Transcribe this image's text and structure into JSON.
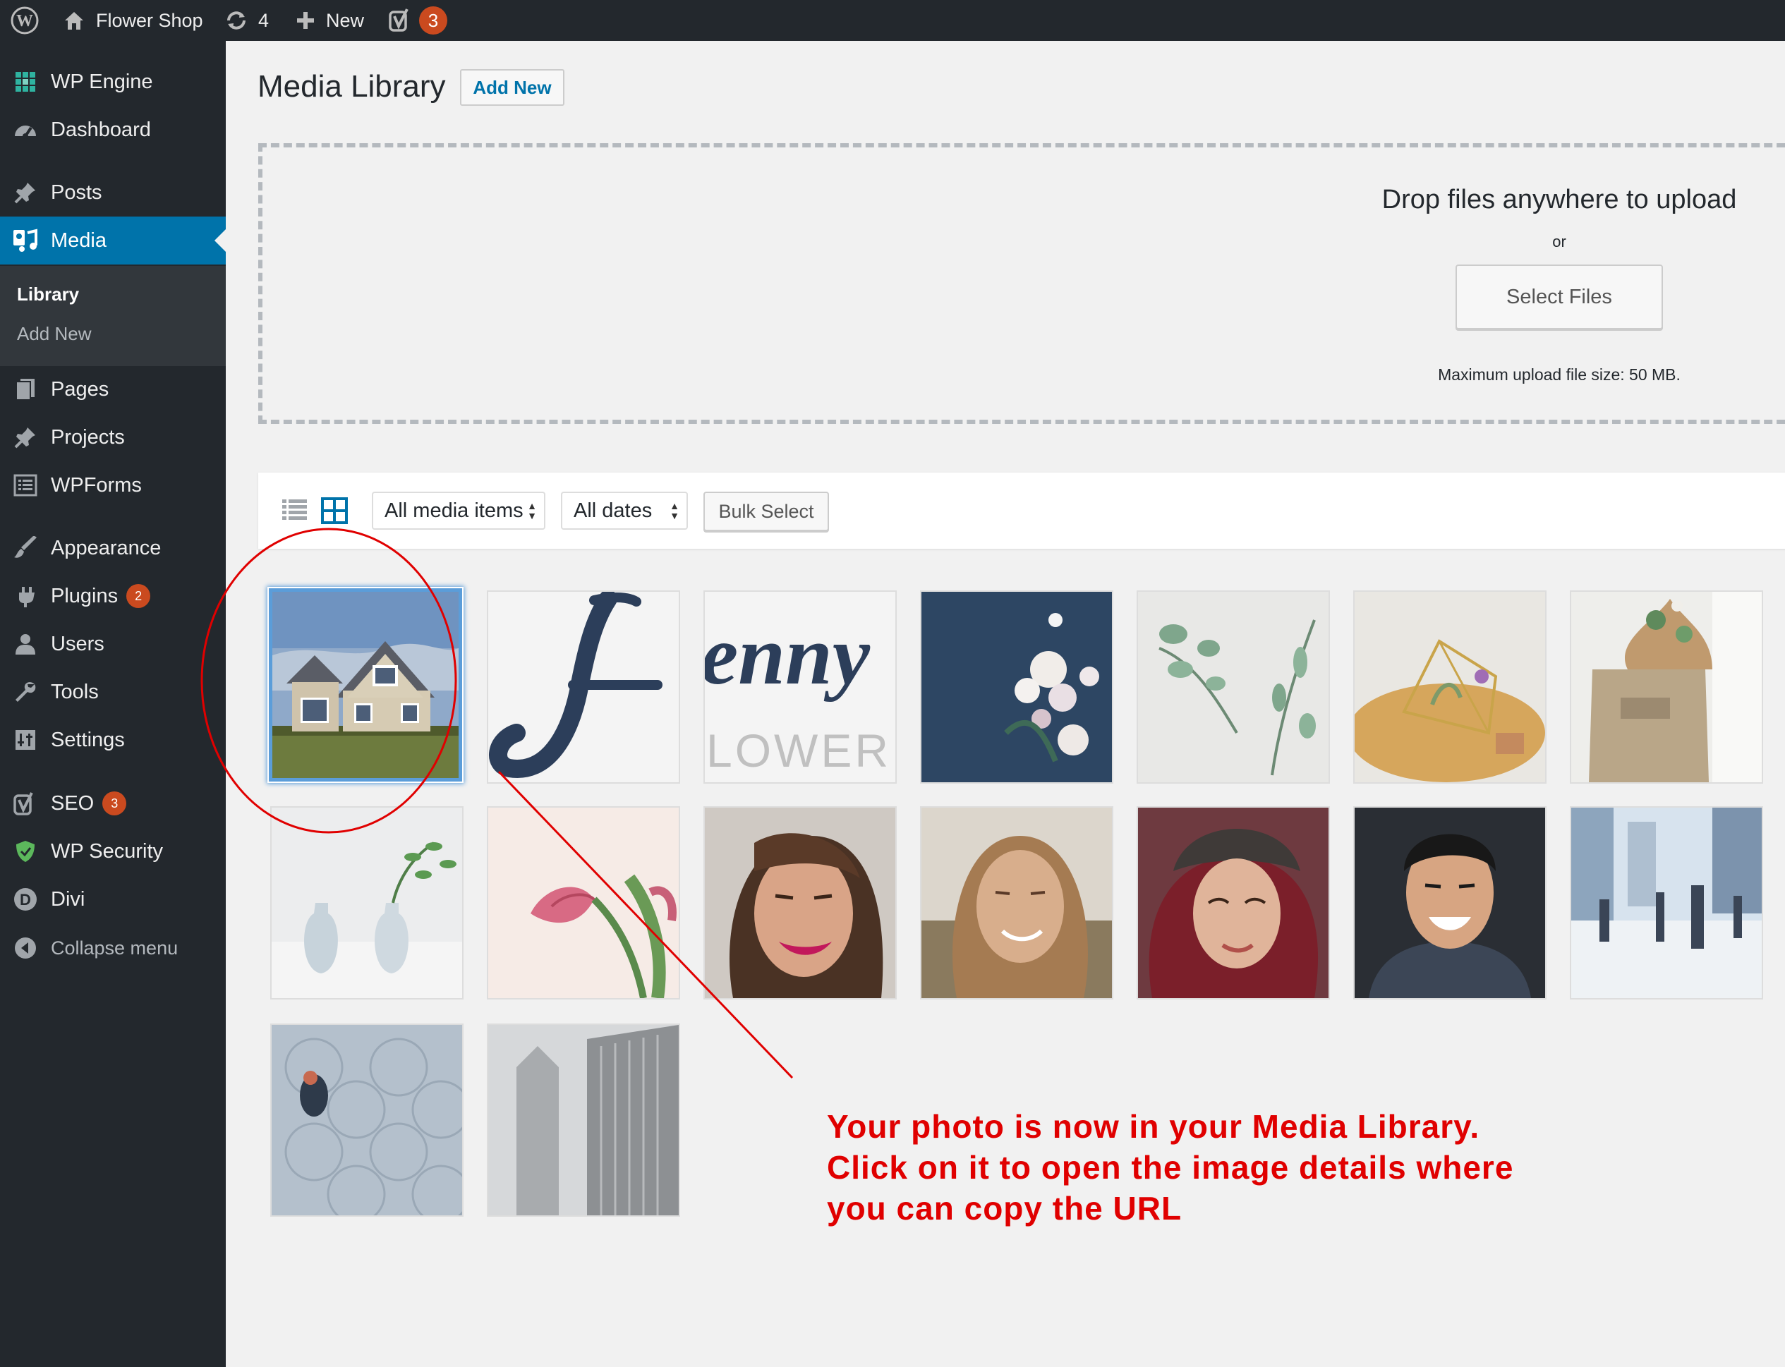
{
  "adminbar": {
    "site_name": "Flower Shop",
    "updates_count": "4",
    "new_label": "New",
    "seo_count": "3"
  },
  "sidebar": {
    "items": [
      {
        "label": "WP Engine",
        "icon": "wp-engine-icon"
      },
      {
        "label": "Dashboard",
        "icon": "dashboard-icon"
      },
      {
        "label": "Posts",
        "icon": "pin-icon"
      },
      {
        "label": "Media",
        "icon": "media-icon"
      },
      {
        "label": "Pages",
        "icon": "pages-icon"
      },
      {
        "label": "Projects",
        "icon": "pin-icon"
      },
      {
        "label": "WPForms",
        "icon": "forms-icon"
      },
      {
        "label": "Appearance",
        "icon": "brush-icon"
      },
      {
        "label": "Plugins",
        "icon": "plugin-icon",
        "badge": "2"
      },
      {
        "label": "Users",
        "icon": "user-icon"
      },
      {
        "label": "Tools",
        "icon": "wrench-icon"
      },
      {
        "label": "Settings",
        "icon": "settings-icon"
      },
      {
        "label": "SEO",
        "icon": "yoast-icon",
        "badge": "3"
      },
      {
        "label": "WP Security",
        "icon": "shield-icon"
      },
      {
        "label": "Divi",
        "icon": "divi-icon"
      },
      {
        "label": "Collapse menu",
        "icon": "collapse-icon"
      }
    ],
    "submenu": [
      {
        "label": "Library"
      },
      {
        "label": "Add New"
      }
    ]
  },
  "main": {
    "title": "Media Library",
    "add_new_label": "Add New",
    "upload": {
      "drop_text": "Drop files anywhere to upload",
      "or_text": "or",
      "select_files_label": "Select Files",
      "max_size_text": "Maximum upload file size: 50 MB."
    },
    "toolbar": {
      "type_filter": "All media items",
      "date_filter": "All dates",
      "bulk_select_label": "Bulk Select"
    }
  },
  "annotation": {
    "lines": [
      "Your photo is now in your Media Library.",
      "Click on it to open the image details where",
      "you can copy the URL"
    ]
  },
  "colors": {
    "accent": "#0073aa",
    "sidebar_bg": "#23282d",
    "badge": "#ca4a1f",
    "annotation": "#e00000"
  }
}
